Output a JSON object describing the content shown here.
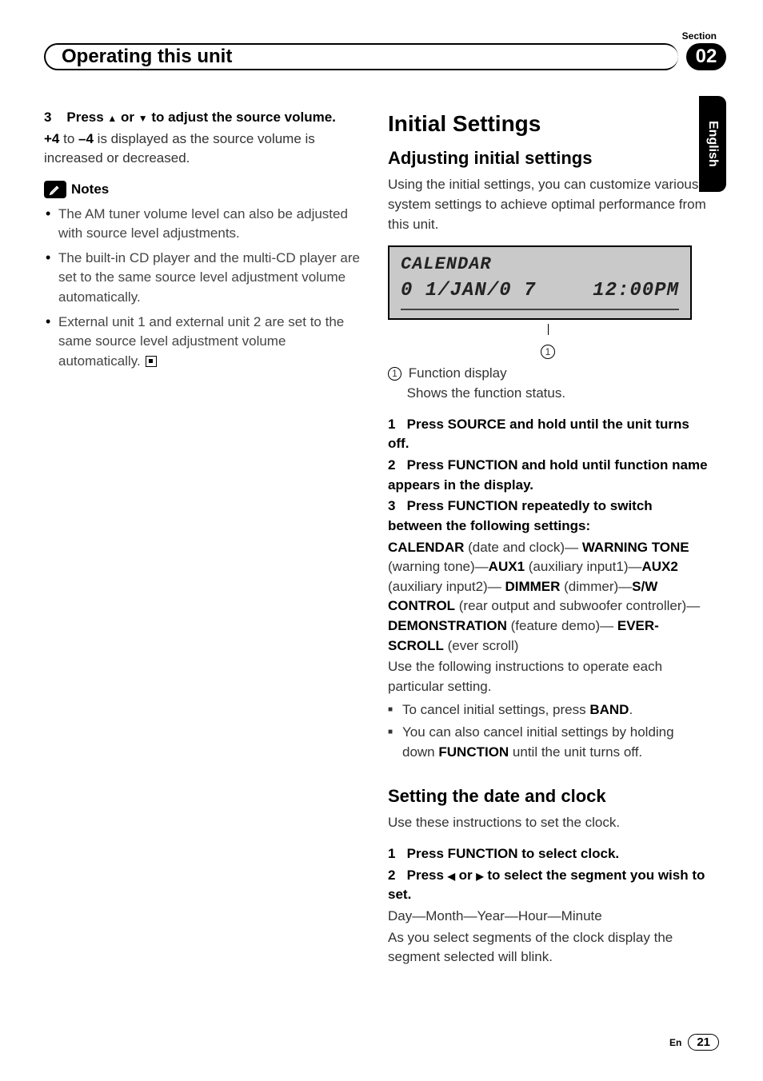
{
  "header": {
    "section_label": "Section",
    "section_number": "02",
    "title": "Operating this unit",
    "language": "English"
  },
  "left": {
    "step3_prefix": "3",
    "step3_text_a": "Press ",
    "step3_text_b": " or ",
    "step3_text_c": " to adjust the source volume.",
    "body1_a": "+4",
    "body1_b": " to ",
    "body1_c": "–4",
    "body1_d": " is displayed as the source volume is increased or decreased.",
    "notes_label": "Notes",
    "notes": [
      "The AM tuner volume level can also be adjusted with source level adjustments.",
      "The built-in CD player and the multi-CD player are set to the same source level adjustment volume automatically.",
      "External unit 1 and external unit 2 are set to the same source level adjustment volume automatically."
    ]
  },
  "right": {
    "h2": "Initial Settings",
    "h3a": "Adjusting initial settings",
    "intro": "Using the initial settings, you can customize various system settings to achieve optimal performance from this unit.",
    "lcd_line1": "CALENDAR",
    "lcd_line2a": "0 1/JAN/0 7",
    "lcd_line2b": "12:00PM",
    "callout_num": "1",
    "callout_label": "Function display",
    "callout_desc": "Shows the function status.",
    "step1_num": "1",
    "step1": "Press SOURCE and hold until the unit turns off.",
    "step2_num": "2",
    "step2": "Press FUNCTION and hold until function name appears in the display.",
    "step3_num": "3",
    "step3": "Press FUNCTION repeatedly to switch between the following settings:",
    "settings_line": {
      "a": "CALENDAR",
      "a2": " (date and clock)—",
      "b": "WARNING TONE",
      "b2": " (warning tone)—",
      "c": "AUX1",
      "c2": " (auxiliary input1)—",
      "d": "AUX2",
      "d2": " (auxiliary input2)—",
      "e": "DIMMER",
      "e2": " (dimmer)—",
      "f": "S/W CONTROL",
      "f2": " (rear output and subwoofer controller)—",
      "g": "DEMONSTRATION",
      "g2": " (feature demo)—",
      "h": "EVER-SCROLL",
      "h2": " (ever scroll)"
    },
    "use_following": "Use the following instructions to operate each particular setting.",
    "sq1_a": "To cancel initial settings, press ",
    "sq1_b": "BAND",
    "sq1_c": ".",
    "sq2_a": "You can also cancel initial settings by holding down ",
    "sq2_b": "FUNCTION",
    "sq2_c": " until the unit turns off.",
    "h3b": "Setting the date and clock",
    "clock_intro": "Use these instructions to set the clock.",
    "cstep1_num": "1",
    "cstep1": "Press FUNCTION to select clock.",
    "cstep2_num": "2",
    "cstep2_a": "Press ",
    "cstep2_b": " or ",
    "cstep2_c": " to select the segment you wish to set.",
    "segments": "Day—Month—Year—Hour—Minute",
    "segments_desc": "As you select segments of the clock display the segment selected will blink."
  },
  "footer": {
    "lang_short": "En",
    "page": "21"
  }
}
